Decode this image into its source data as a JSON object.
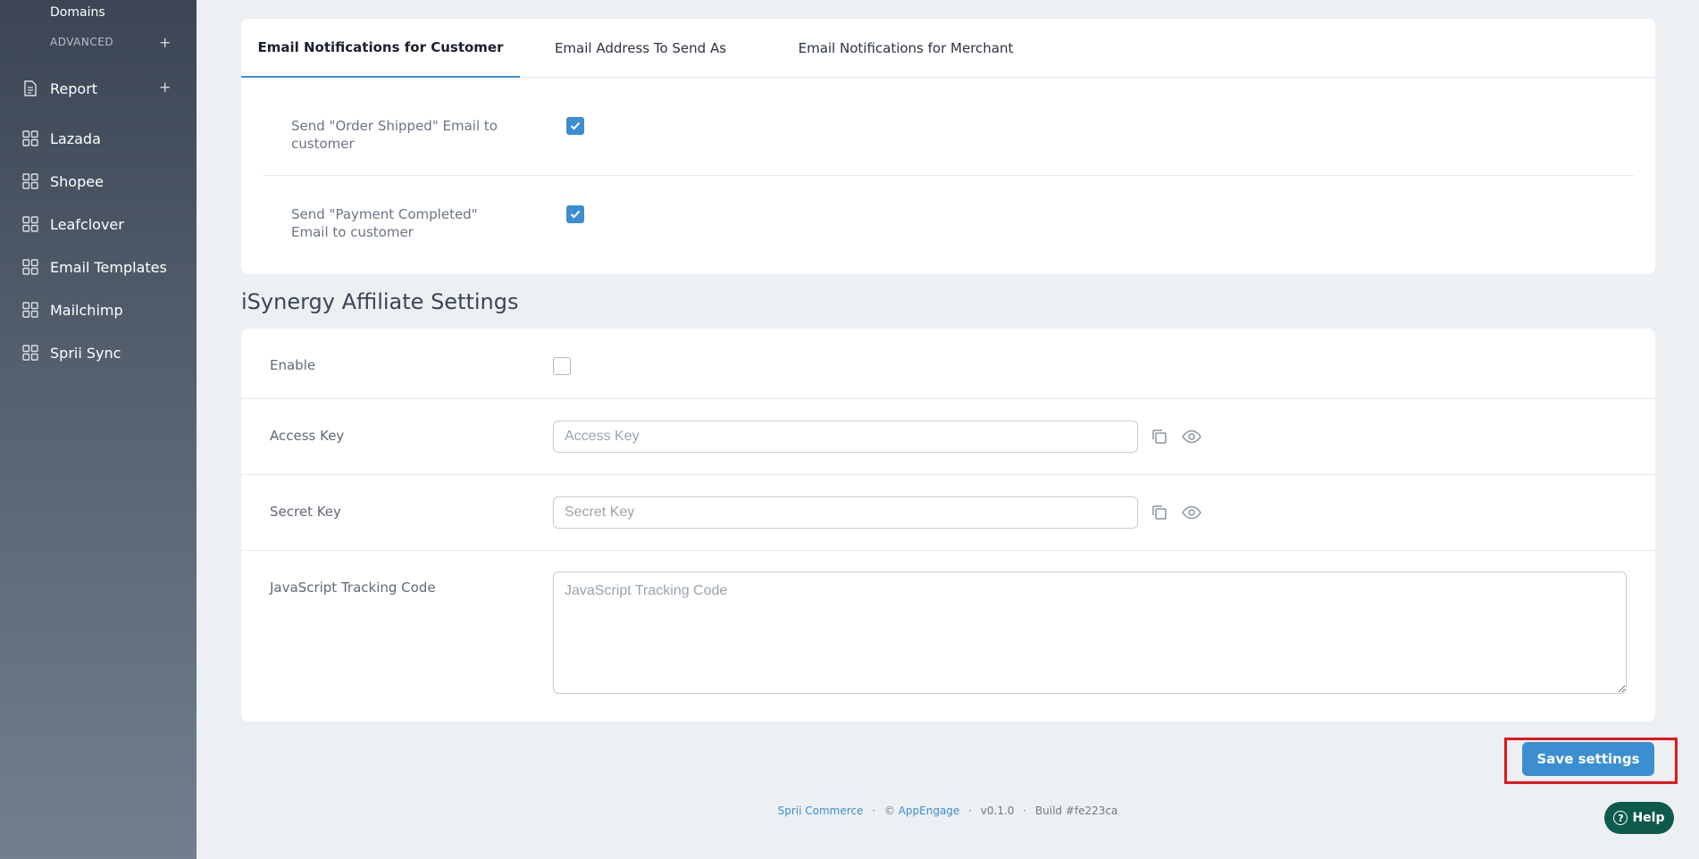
{
  "sidebar": {
    "sub_item": "Domains",
    "section_label": "ADVANCED",
    "plus": "+",
    "items": [
      {
        "label": "Report",
        "icon": "document-icon"
      },
      {
        "label": "Lazada",
        "icon": "grid-icon"
      },
      {
        "label": "Shopee",
        "icon": "grid-icon"
      },
      {
        "label": "Leafclover",
        "icon": "grid-icon"
      },
      {
        "label": "Email Templates",
        "icon": "grid-icon"
      },
      {
        "label": "Mailchimp",
        "icon": "grid-icon"
      },
      {
        "label": "Sprii Sync",
        "icon": "grid-icon"
      }
    ]
  },
  "email_card": {
    "tabs": [
      {
        "label": "Email Notifications for Customer",
        "active": true
      },
      {
        "label": "Email Address To Send As",
        "active": false
      },
      {
        "label": "Email Notifications for Merchant",
        "active": false
      }
    ],
    "options": [
      {
        "label": "Send \"Order Shipped\" Email to customer",
        "checked": true
      },
      {
        "label": "Send \"Payment Completed\" Email to customer",
        "checked": true
      }
    ]
  },
  "affiliate": {
    "title": "iSynergy Affiliate Settings",
    "enable_label": "Enable",
    "enable_checked": false,
    "access_key_label": "Access Key",
    "access_key_placeholder": "Access Key",
    "secret_key_label": "Secret Key",
    "secret_key_placeholder": "Secret Key",
    "tracking_label": "JavaScript Tracking Code",
    "tracking_placeholder": "JavaScript Tracking Code"
  },
  "actions": {
    "save_label": "Save settings"
  },
  "footer": {
    "brand": "Sprii Commerce",
    "sep": "·",
    "copyright": "©",
    "company": "AppEngage",
    "version": "v0.1.0",
    "build": "Build #fe223ca"
  },
  "help": {
    "label": "Help",
    "icon_glyph": "?"
  },
  "colors": {
    "accent": "#3b8ed0",
    "highlight": "#e8141c",
    "help_bg": "#0e5a4c"
  }
}
